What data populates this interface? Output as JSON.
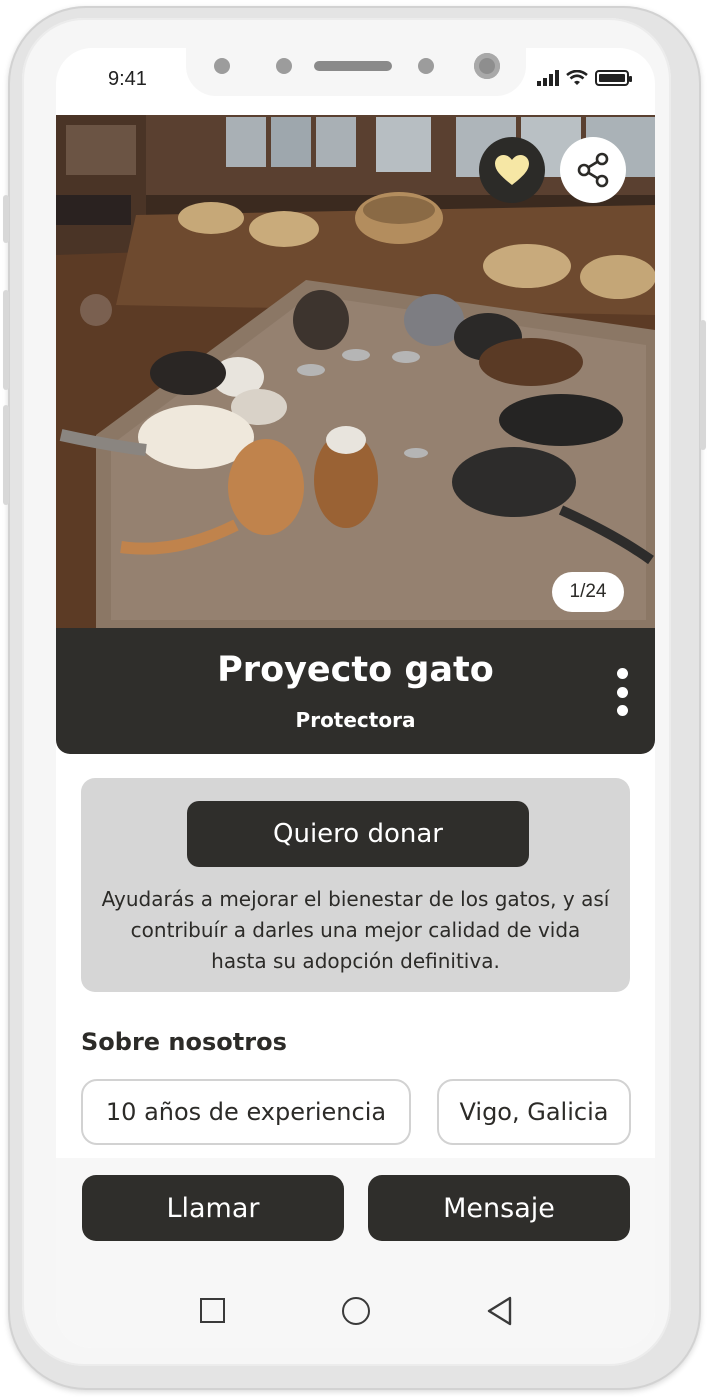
{
  "status_bar": {
    "time": "9:41"
  },
  "hero": {
    "photo_counter": "1/24",
    "favorite_icon": "heart-icon",
    "share_icon": "share-icon"
  },
  "profile": {
    "name": "Proyecto gato",
    "type": "Protectora",
    "more_icon": "more-vertical-icon"
  },
  "donate": {
    "button_label": "Quiero donar",
    "description": "Ayudarás a mejorar el bienestar de los gatos, y así contribuír a darles una mejor calidad de vida hasta su adopción definitiva."
  },
  "about": {
    "title": "Sobre nosotros",
    "chips": [
      "10 años de experiencia",
      "Vigo, Galicia"
    ]
  },
  "actions": {
    "call_label": "Llamar",
    "message_label": "Mensaje"
  },
  "nav": {
    "items": [
      "recent-apps-icon",
      "home-icon",
      "back-icon"
    ]
  },
  "colors": {
    "dark": "#2f2e2b",
    "card": "#d6d6d6",
    "heart": "#f6e7a5",
    "background": "#ffffff"
  }
}
